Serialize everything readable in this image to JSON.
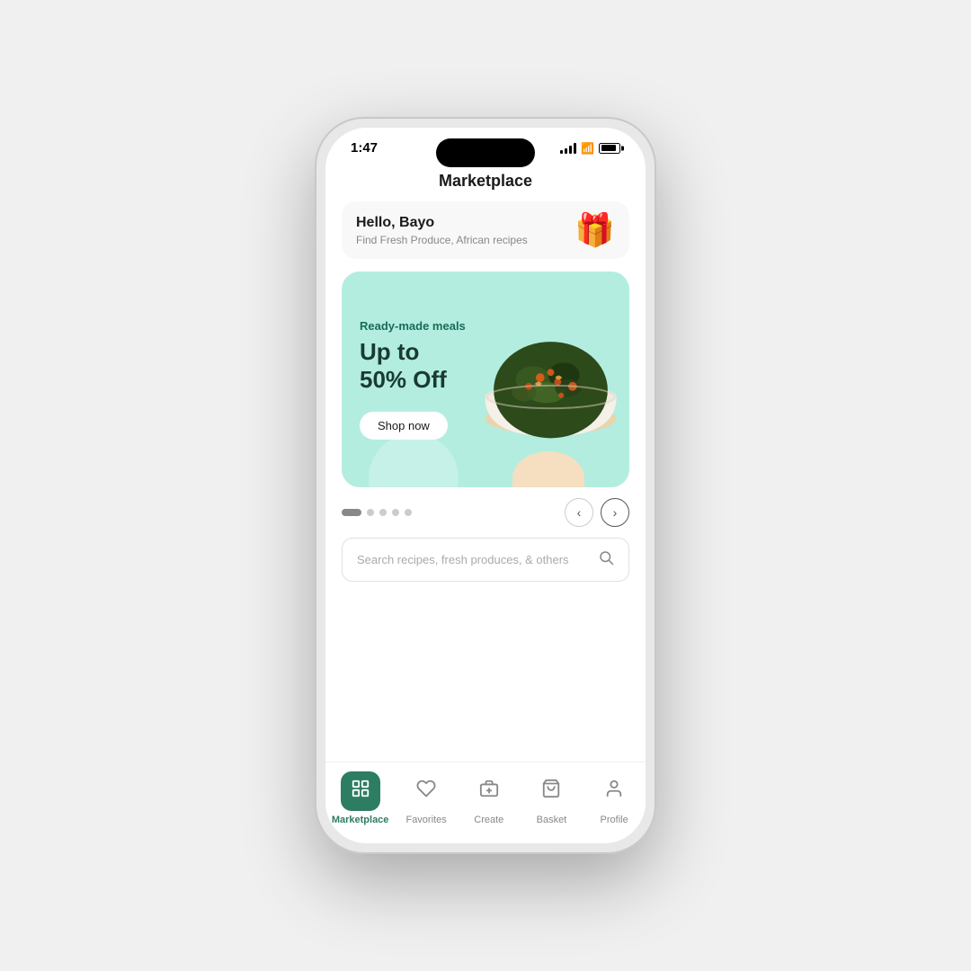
{
  "phone": {
    "time": "1:47",
    "dynamic_island": true
  },
  "page": {
    "title": "Marketplace"
  },
  "hello_card": {
    "greeting": "Hello, Bayo",
    "subtitle": "Find Fresh Produce, African recipes",
    "emoji": "🎁"
  },
  "banner": {
    "subtitle": "Ready-made meals",
    "title_line1": "Up to",
    "title_line2": "50% Off",
    "cta": "Shop now"
  },
  "carousel": {
    "dots": [
      true,
      false,
      false,
      false,
      false
    ],
    "active_dot": 0
  },
  "search": {
    "placeholder": "Search recipes, fresh produces, & others"
  },
  "bottom_nav": {
    "items": [
      {
        "id": "marketplace",
        "label": "Marketplace",
        "active": true
      },
      {
        "id": "favorites",
        "label": "Favorites",
        "active": false
      },
      {
        "id": "create",
        "label": "Create",
        "active": false
      },
      {
        "id": "basket",
        "label": "Basket",
        "active": false
      },
      {
        "id": "profile",
        "label": "Profile",
        "active": false
      }
    ]
  }
}
